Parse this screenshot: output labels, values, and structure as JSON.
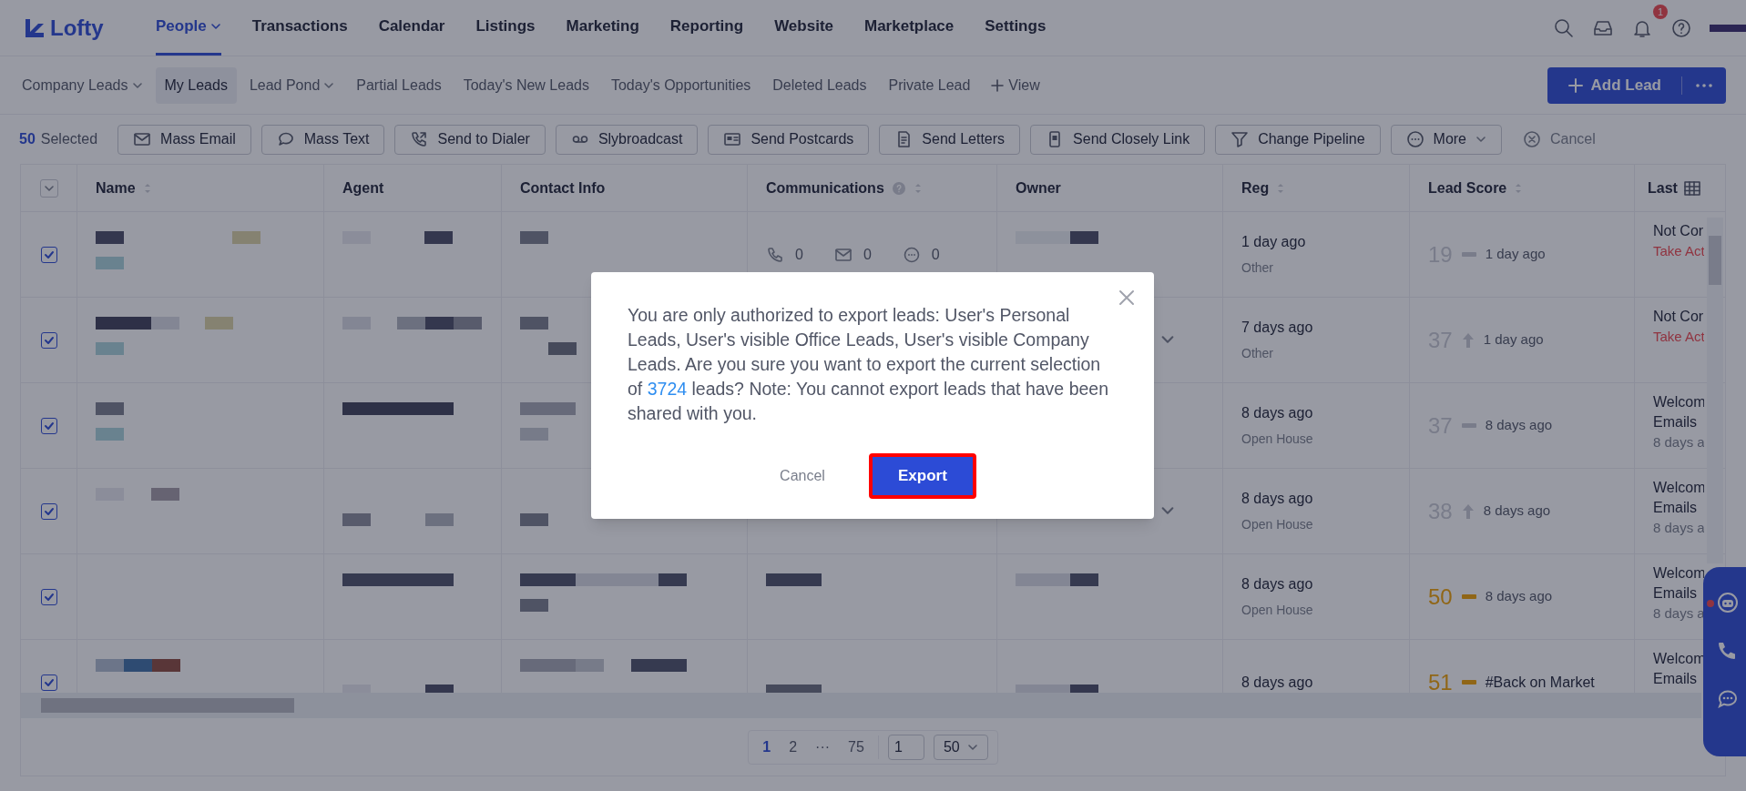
{
  "brand": {
    "name": "Lofty"
  },
  "nav": [
    {
      "label": "People",
      "selected": true,
      "caret": true
    },
    {
      "label": "Transactions",
      "selected": false,
      "caret": false
    },
    {
      "label": "Calendar",
      "selected": false,
      "caret": false
    },
    {
      "label": "Listings",
      "selected": false,
      "caret": false
    },
    {
      "label": "Marketing",
      "selected": false,
      "caret": false
    },
    {
      "label": "Reporting",
      "selected": false,
      "caret": false
    },
    {
      "label": "Website",
      "selected": false,
      "caret": false
    },
    {
      "label": "Marketplace",
      "selected": false,
      "caret": false
    },
    {
      "label": "Settings",
      "selected": false,
      "caret": false
    }
  ],
  "notifications": {
    "badge": "1"
  },
  "views": [
    {
      "label": "Company Leads",
      "selected": false,
      "caret": true
    },
    {
      "label": "My Leads",
      "selected": true,
      "caret": false
    },
    {
      "label": "Lead Pond",
      "selected": false,
      "caret": true
    },
    {
      "label": "Partial Leads",
      "selected": false,
      "caret": false
    },
    {
      "label": "Today's New Leads",
      "selected": false,
      "caret": false
    },
    {
      "label": "Today's Opportunities",
      "selected": false,
      "caret": false
    },
    {
      "label": "Deleted Leads",
      "selected": false,
      "caret": false
    },
    {
      "label": "Private Lead",
      "selected": false,
      "caret": false
    }
  ],
  "add_view": "View",
  "add_lead": "Add Lead",
  "selection": {
    "count": "50",
    "label": "Selected"
  },
  "actions": [
    {
      "label": "Mass Email"
    },
    {
      "label": "Mass Text"
    },
    {
      "label": "Send to Dialer"
    },
    {
      "label": "Slybroadcast"
    },
    {
      "label": "Send Postcards"
    },
    {
      "label": "Send Letters"
    },
    {
      "label": "Send Closely Link"
    },
    {
      "label": "Change Pipeline"
    },
    {
      "label": "More"
    }
  ],
  "cancel_selection": "Cancel",
  "table": {
    "select_all_checked": false,
    "columns": [
      {
        "label": "Name",
        "sortable": true,
        "help": false
      },
      {
        "label": "Agent",
        "sortable": false,
        "help": false
      },
      {
        "label": "Contact Info",
        "sortable": false,
        "help": false
      },
      {
        "label": "Communications",
        "sortable": true,
        "help": true
      },
      {
        "label": "Owner",
        "sortable": false,
        "help": false
      },
      {
        "label": "Reg",
        "sortable": true,
        "help": false
      },
      {
        "label": "Lead Score",
        "sortable": true,
        "help": false
      },
      {
        "label": "Last",
        "sortable": false,
        "help": false
      }
    ],
    "rows": [
      {
        "checked": true,
        "comms": [
          "0",
          "0",
          "0"
        ],
        "owner_menu": false,
        "reg": "1 day ago",
        "source": "Other",
        "score": "19",
        "hot": false,
        "rising": false,
        "score_time": "1 day ago",
        "last": [
          "Not Cor"
        ],
        "last_action": "Take Act"
      },
      {
        "checked": true,
        "owner_menu": true,
        "reg": "7 days ago",
        "source": "Other",
        "score": "37",
        "hot": false,
        "rising": true,
        "score_time": "1 day ago",
        "last": [
          "Not Cor"
        ],
        "last_action": "Take Act"
      },
      {
        "checked": true,
        "owner_menu": false,
        "reg": "8 days ago",
        "source": "Open House",
        "score": "37",
        "hot": false,
        "rising": false,
        "score_time": "8 days ago",
        "last": [
          "Welcom",
          "Emails",
          "8 days a"
        ]
      },
      {
        "checked": true,
        "owner_menu": true,
        "reg": "8 days ago",
        "source": "Open House",
        "score": "38",
        "hot": false,
        "rising": true,
        "score_time": "8 days ago",
        "last": [
          "Welcom",
          "Emails",
          "8 days a"
        ]
      },
      {
        "checked": true,
        "owner_menu": false,
        "reg": "8 days ago",
        "source": "Open House",
        "score": "50",
        "hot": true,
        "rising": false,
        "score_time": "8 days ago",
        "last": [
          "Welcom",
          "Emails",
          "8 days a"
        ]
      },
      {
        "checked": true,
        "owner_menu": false,
        "reg": "8 days ago",
        "score": "51",
        "hot": true,
        "rising": false,
        "score_tag": "#Back on Market",
        "last": [
          "Welcom",
          "Emails"
        ]
      }
    ]
  },
  "pagination": {
    "pages": [
      {
        "label": "1",
        "selected": true
      },
      {
        "label": "2",
        "selected": false
      },
      {
        "label": "···",
        "selected": false
      },
      {
        "label": "75",
        "selected": false
      }
    ],
    "jump": "1",
    "page_size": "50"
  },
  "dialog": {
    "message_start": "You are only authorized to export leads: User's Personal Leads, User's visible Office Leads, User's visible Company Leads. Are you sure you want to export the current selection of",
    "count": "3724",
    "message_end": "leads? Note: You cannot export leads that have been shared with you.",
    "cancel": "Cancel",
    "confirm": "Export",
    "confirm_highlighted": true
  }
}
